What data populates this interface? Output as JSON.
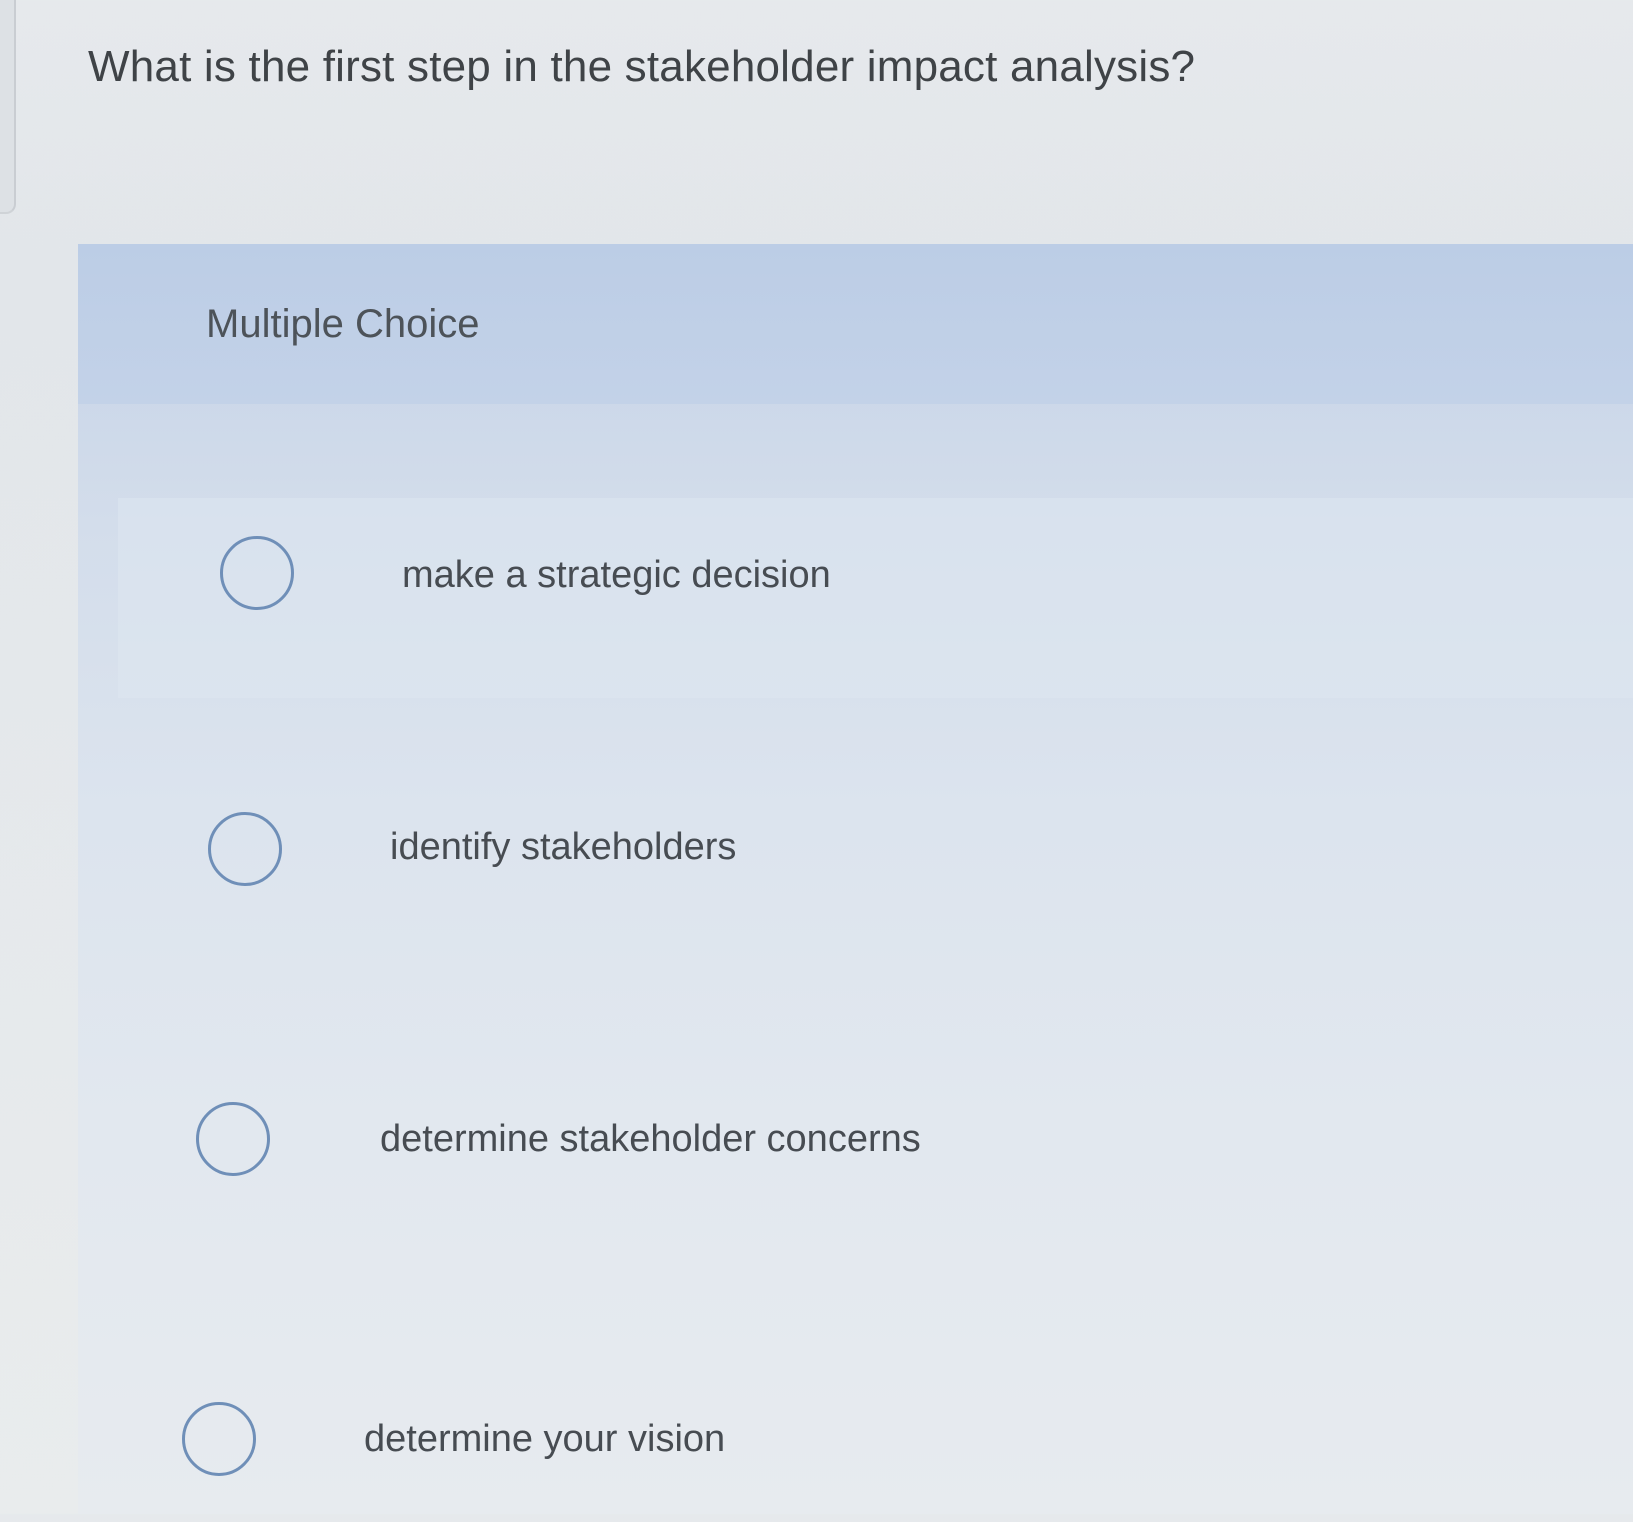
{
  "question": {
    "text": "What is the first step in the stakeholder impact analysis?"
  },
  "question_type": {
    "label": "Multiple Choice"
  },
  "options": [
    {
      "label": "make a strategic decision",
      "selected": false
    },
    {
      "label": "identify stakeholders",
      "selected": false
    },
    {
      "label": "determine stakeholder concerns",
      "selected": false
    },
    {
      "label": "determine your vision",
      "selected": false
    }
  ],
  "colors": {
    "panel_header": "#c3d2e8",
    "radio_border": "#6f8fb8",
    "text": "#474c52"
  }
}
